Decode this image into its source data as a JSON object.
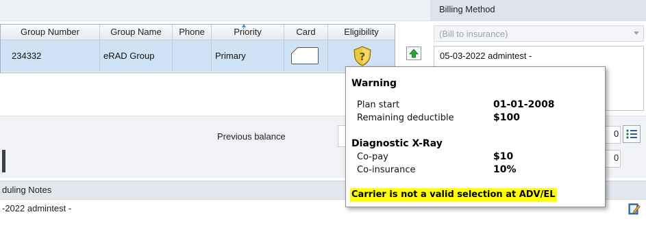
{
  "billing": {
    "title": "Billing Method",
    "select_placeholder": "(Bill to insurance)",
    "note": "05-03-2022 admintest -"
  },
  "grid": {
    "columns": [
      "Group Number",
      "Group Name",
      "Phone",
      "Priority",
      "Card",
      "Eligibility"
    ],
    "row": {
      "group_number": "234332",
      "group_name": "eRAD Group",
      "phone": "",
      "priority": "Primary"
    }
  },
  "summary": {
    "previous_balance_label": "Previous balance",
    "right_value_a": "0",
    "right_value_b": "0"
  },
  "scheduling": {
    "title": "duling Notes",
    "note": "-2022 admintest -"
  },
  "tooltip": {
    "heading": "Warning",
    "plan_start_label": "Plan start",
    "plan_start_value": "01-01-2008",
    "remaining_deductible_label": "Remaining deductible",
    "remaining_deductible_value": "$100",
    "service_name": "Diagnostic X-Ray",
    "copay_label": "Co-pay",
    "copay_value": "$10",
    "coinsurance_label": "Co-insurance",
    "coinsurance_value": "10%",
    "alert": "Carrier is not a valid selection at ADV/EL"
  },
  "icons": {
    "eligibility": "question-shield-icon",
    "move_up": "up-arrow-icon",
    "card": "insurance-card-icon",
    "list": "list-icon",
    "edit": "edit-note-icon"
  },
  "colors": {
    "selected_row": "#cfe3f4",
    "alert_highlight": "#ffff00",
    "eligibility_shield": "#e8c840",
    "up_arrow": "#2aa52a"
  }
}
